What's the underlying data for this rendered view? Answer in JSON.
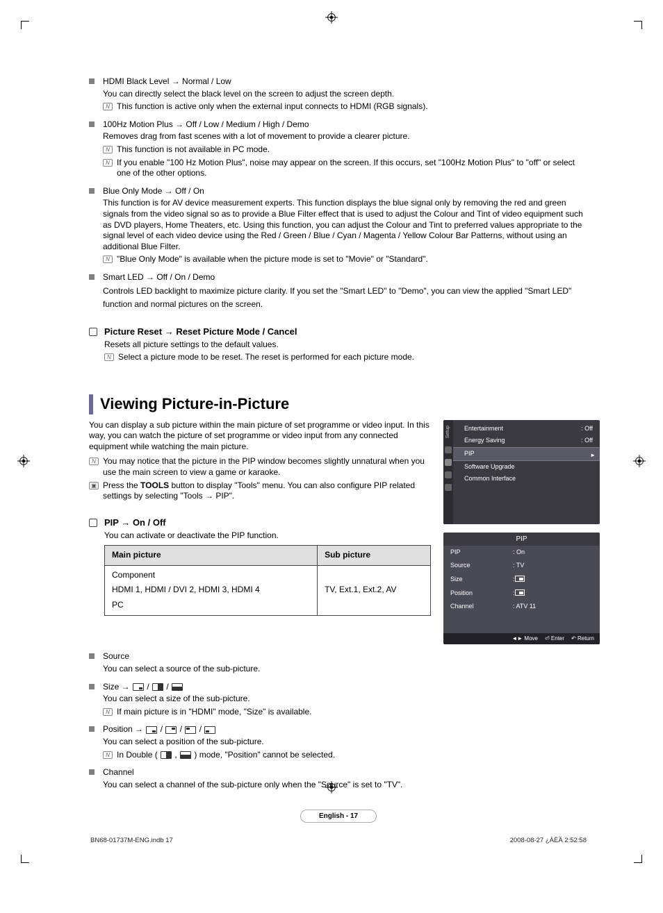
{
  "items": [
    {
      "title": "HDMI Black Level → Normal / Low",
      "desc": "You can directly select the black level on the screen to adjust the screen depth.",
      "notes": [
        "This function is active only when the external input connects to HDMI (RGB signals)."
      ]
    },
    {
      "title": "100Hz Motion Plus → Off / Low / Medium / High / Demo",
      "desc": "Removes drag from fast scenes with a lot of movement to provide a clearer picture.",
      "notes": [
        "This function is not available in PC mode.",
        "If you enable \"100 Hz Motion Plus\", noise may appear on the screen. If this occurs, set \"100Hz Motion Plus\" to \"off\" or select one of the other options."
      ]
    },
    {
      "title": "Blue Only Mode → Off / On",
      "desc": "This function is for AV device measurement experts. This function displays the blue signal only by removing the red and green signals from the video signal so as to provide a Blue Filter effect that is used to adjust the Colour and Tint of video equipment such as DVD players, Home Theaters, etc. Using this function, you can adjust the Colour and Tint to preferred values appropriate to the signal level of each video device using the Red / Green / Blue / Cyan / Magenta / Yellow Colour Bar Patterns, without using an additional Blue Filter.",
      "notes": [
        "\"Blue Only Mode\" is available when the picture mode is set to \"Movie\" or \"Standard\"."
      ]
    },
    {
      "title": "Smart LED → Off / On / Demo",
      "desc": "Controls LED backlight to maximize picture clarity. If you set the \"Smart LED\" to \"Demo\", you can view the applied \"Smart LED\" function and normal pictures on the screen.",
      "notes": []
    }
  ],
  "reset": {
    "title": "Picture Reset → Reset Picture Mode / Cancel",
    "desc": "Resets all picture settings to the default values.",
    "note": "Select a picture mode to be reset. The reset is performed for each picture mode."
  },
  "heading": "Viewing Picture-in-Picture",
  "intro": "You can display a sub picture within the main picture of set programme or video input. In this way, you can watch the picture of set programme or video input from any connected equipment while watching the main picture.",
  "intro_notes": [
    {
      "icon": "note",
      "text": "You may notice that the picture in the PIP window becomes slightly unnatural when you use the main screen to view a game or karaoke."
    },
    {
      "icon": "tools",
      "text_pre": "Press the ",
      "text_bold": "TOOLS",
      "text_post": " button to display \"Tools\" menu. You can also configure PIP related settings by selecting \"Tools → PIP\"."
    }
  ],
  "pip_section": {
    "title": "PIP → On / Off",
    "desc": "You can activate or deactivate the PIP function."
  },
  "table": {
    "h1": "Main picture",
    "h2": "Sub picture",
    "r1c1a": "Component",
    "r1c1b": "HDMI 1, HDMI / DVI 2, HDMI 3, HDMI 4",
    "r1c1c": "PC",
    "r1c2": "TV, Ext.1, Ext.2, AV"
  },
  "subs": [
    {
      "title": "Source",
      "desc": "You can select a source of the sub-picture.",
      "notes": []
    },
    {
      "title_pre": "Size → ",
      "desc": "You can select a size of the sub-picture.",
      "notes": [
        "If main picture is in \"HDMI\" mode, \"Size\" is available."
      ],
      "icons": "size"
    },
    {
      "title_pre": "Position → ",
      "desc": "You can select a position of the sub-picture.",
      "notes": [
        "In Double (        ,        ) mode, \"Position\" cannot be selected."
      ],
      "icons": "position"
    },
    {
      "title": "Channel",
      "desc": "You can select a channel of the sub-picture only when the \"Source\" is set to \"TV\".",
      "notes": []
    }
  ],
  "osd1": {
    "sidebar_label": "Setup",
    "rows": [
      {
        "k": "Entertainment",
        "v": ": Off"
      },
      {
        "k": "Energy Saving",
        "v": ": Off"
      }
    ],
    "highlight": "PIP",
    "below": [
      "Software Upgrade",
      "Common Interface"
    ]
  },
  "osd2": {
    "title": "PIP",
    "rows": [
      {
        "k": "PIP",
        "v": ": On"
      },
      {
        "k": "Source",
        "v": ": TV"
      },
      {
        "k": "Size",
        "v": ":"
      },
      {
        "k": "Position",
        "v": ":"
      },
      {
        "k": "Channel",
        "v": ": ATV 11"
      }
    ],
    "foot": {
      "move": "Move",
      "enter": "Enter",
      "return": "Return"
    }
  },
  "page_badge": "English - 17",
  "footer": {
    "left": "BN68-01737M-ENG.indb   17",
    "right": "2008-08-27   ¿ÀÈÄ 2:52:58"
  }
}
